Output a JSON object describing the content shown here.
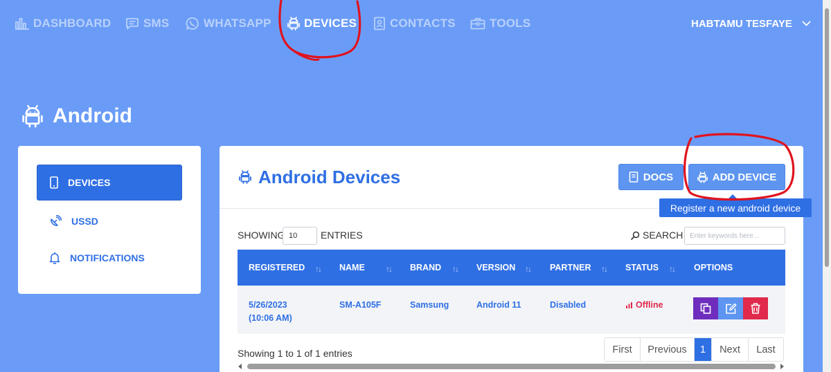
{
  "nav": {
    "items": [
      {
        "label": "DASHBOARD",
        "icon": "bar-chart-icon"
      },
      {
        "label": "SMS",
        "icon": "message-icon"
      },
      {
        "label": "WHATSAPP",
        "icon": "whatsapp-icon"
      },
      {
        "label": "DEVICES",
        "icon": "android-icon",
        "active": true
      },
      {
        "label": "CONTACTS",
        "icon": "contact-card-icon"
      },
      {
        "label": "TOOLS",
        "icon": "toolbox-icon"
      }
    ],
    "user": "HABTAMU TESFAYE"
  },
  "page": {
    "title": "Android"
  },
  "sidebar": {
    "items": [
      {
        "label": "DEVICES",
        "icon": "mobile-icon",
        "active": true
      },
      {
        "label": "USSD",
        "icon": "satellite-icon"
      },
      {
        "label": "NOTIFICATIONS",
        "icon": "bell-icon"
      }
    ]
  },
  "card": {
    "title": "Android Devices",
    "docs_label": "DOCS",
    "add_label": "ADD DEVICE",
    "tooltip": "Register a new android device"
  },
  "table": {
    "showing_label": "SHOWING",
    "entries_value": "10",
    "entries_label": "ENTRIES",
    "search_label": "SEARCH",
    "search_placeholder": "Enter keywords here...",
    "columns": [
      "REGISTERED",
      "NAME",
      "BRAND",
      "VERSION",
      "PARTNER",
      "STATUS",
      "OPTIONS"
    ],
    "rows": [
      {
        "registered_date": "5/26/2023",
        "registered_time": "(10:06 AM)",
        "name": "SM-A105F",
        "brand": "Samsung",
        "version": "Android 11",
        "partner": "Disabled",
        "status": "Offline"
      }
    ],
    "info": "Showing 1 to 1 of 1 entries"
  },
  "pagination": {
    "first": "First",
    "previous": "Previous",
    "current": "1",
    "next": "Next",
    "last": "Last"
  },
  "colors": {
    "page_bg": "#6a9cf7",
    "accent": "#2f6fe4",
    "status_offline": "#e0294b",
    "opt_copy": "#6f2dbd",
    "opt_edit": "#5d95f0",
    "opt_delete": "#e0294b",
    "annotation": "#e0131e"
  }
}
